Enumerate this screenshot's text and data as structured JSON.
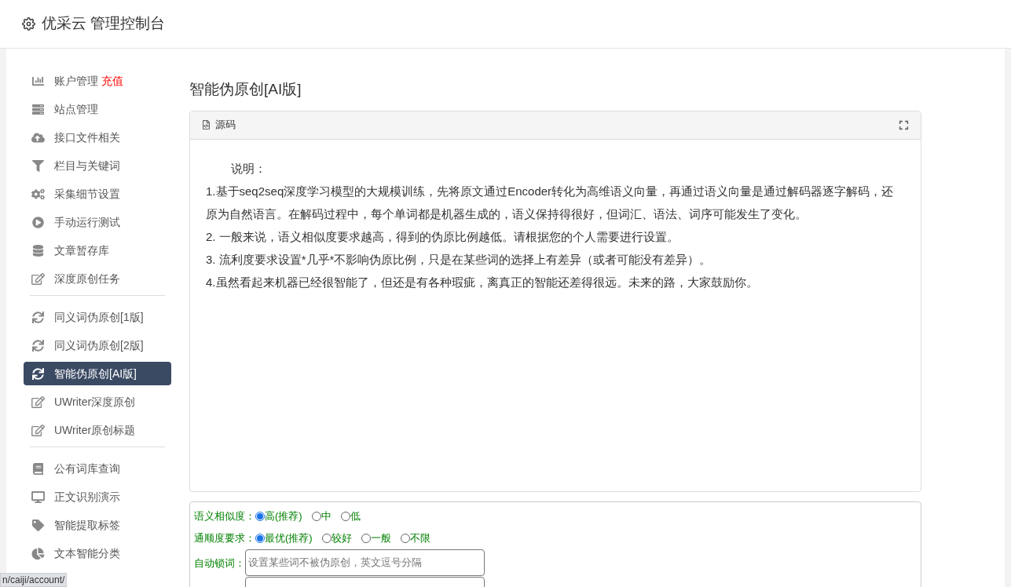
{
  "header": {
    "title": "优采云 管理控制台"
  },
  "sidebar": {
    "groups": [
      {
        "items": [
          {
            "label": "账户管理",
            "badge": "充值",
            "selected": false
          },
          {
            "label": "站点管理",
            "selected": false
          },
          {
            "label": "接口文件相关",
            "selected": false
          },
          {
            "label": "栏目与关键词",
            "selected": false
          },
          {
            "label": "采集细节设置",
            "selected": false
          },
          {
            "label": "手动运行测试",
            "selected": false
          },
          {
            "label": "文章暂存库",
            "selected": false
          },
          {
            "label": "深度原创任务",
            "selected": false
          }
        ]
      },
      {
        "items": [
          {
            "label": "同义词伪原创[1版]",
            "selected": false
          },
          {
            "label": "同义词伪原创[2版]",
            "selected": false
          },
          {
            "label": "智能伪原创[AI版]",
            "selected": true
          },
          {
            "label": "UWriter深度原创",
            "selected": false
          },
          {
            "label": "UWriter原创标题",
            "selected": false
          }
        ]
      },
      {
        "items": [
          {
            "label": "公有词库查询",
            "selected": false
          },
          {
            "label": "正文识别演示",
            "selected": false
          },
          {
            "label": "智能提取标签",
            "selected": false
          },
          {
            "label": "文本智能分类",
            "selected": false
          }
        ]
      }
    ]
  },
  "page_title": "智能伪原创[AI版]",
  "editor": {
    "tab": "源码",
    "lines": [
      "说明：",
      "1.基于seq2seq深度学习模型的大规模训练，先将原文通过Encoder转化为高维语义向量，再通过语义向量是通过解码器逐字解码，还原为自然语言。在解码过程中，每个单词都是机器生成的，语义保持得很好，但词汇、语法、词序可能发生了变化。",
      "2. 一般来说，语义相似度要求越高，得到的伪原比例越低。请根据您的个人需要进行设置。",
      "3. 流利度要求设置*几乎*不影响伪原比例，只是在某些词的选择上有差异（或者可能没有差异）。",
      "4.虽然看起来机器已经很智能了，但还是有各种瑕疵，离真正的智能还差得很远。未来的路，大家鼓励你。"
    ]
  },
  "options": [
    {
      "label": "语义相似度：",
      "choices": [
        {
          "label": "高(推荐)",
          "selected": true
        },
        {
          "label": "中",
          "selected": false
        },
        {
          "label": "低",
          "selected": false
        }
      ]
    },
    {
      "label": "通顺度要求：",
      "choices": [
        {
          "label": "最优(推荐)",
          "selected": true
        },
        {
          "label": "较好",
          "selected": false
        },
        {
          "label": "一般",
          "selected": false
        },
        {
          "label": "不限",
          "selected": false
        }
      ]
    }
  ],
  "lock_words": {
    "label": "自动锁词：",
    "placeholder": "设置某些词不被伪原创，英文逗号分隔"
  },
  "status_url": "n/caiji/account/"
}
